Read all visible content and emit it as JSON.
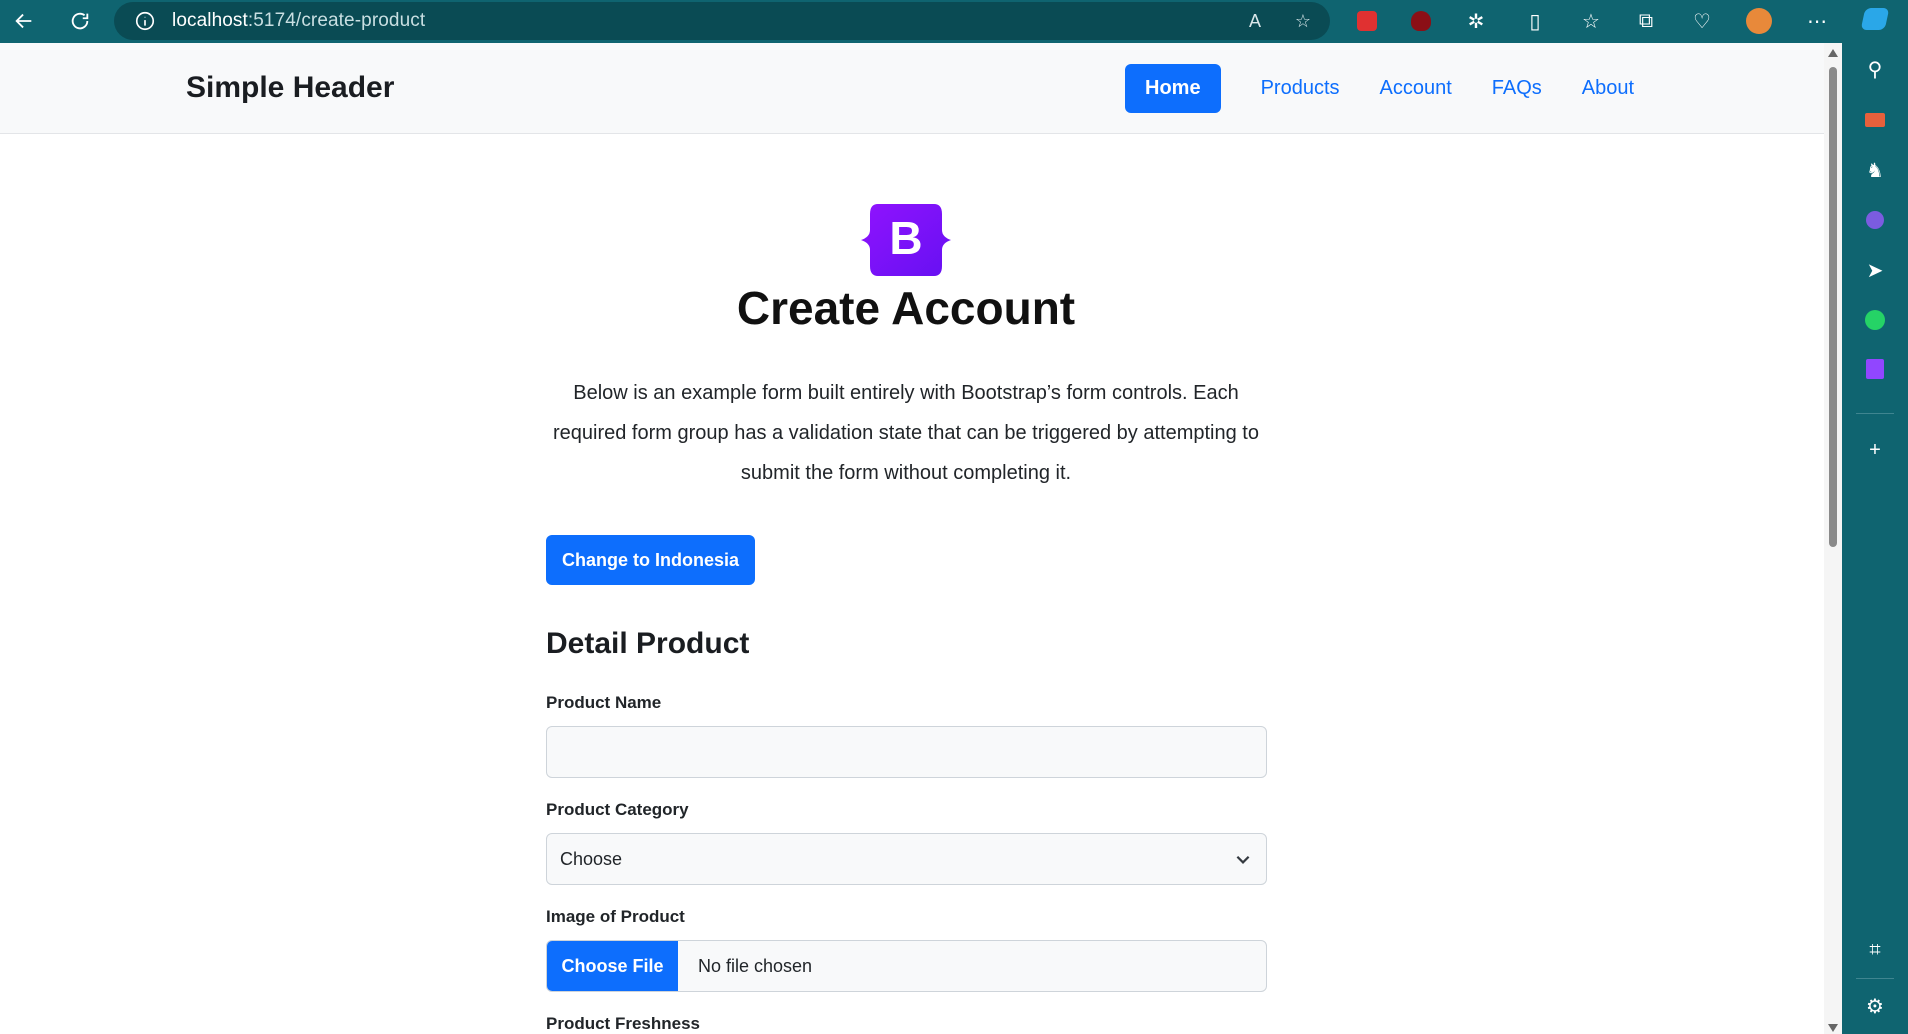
{
  "browser": {
    "url_host": "localhost",
    "url_path": ":5174/create-product"
  },
  "header": {
    "brand": "Simple Header",
    "nav": [
      "Home",
      "Products",
      "Account",
      "FAQs",
      "About"
    ]
  },
  "main": {
    "logo_letter": "B",
    "title": "Create Account",
    "lead": "Below is an example form built entirely with Bootstrap’s form controls. Each required form group has a validation state that can be triggered by attempting to submit the form without completing it.",
    "language_button": "Change to Indonesia",
    "section_title": "Detail Product",
    "fields": {
      "product_name_label": "Product Name",
      "product_name_value": "",
      "product_category_label": "Product Category",
      "product_category_value": "Choose",
      "image_label": "Image of Product",
      "file_button": "Choose File",
      "file_status": "No file chosen",
      "freshness_label": "Product Freshness"
    }
  },
  "colors": {
    "primary": "#0d6efd",
    "browser_chrome": "#0f6470"
  }
}
